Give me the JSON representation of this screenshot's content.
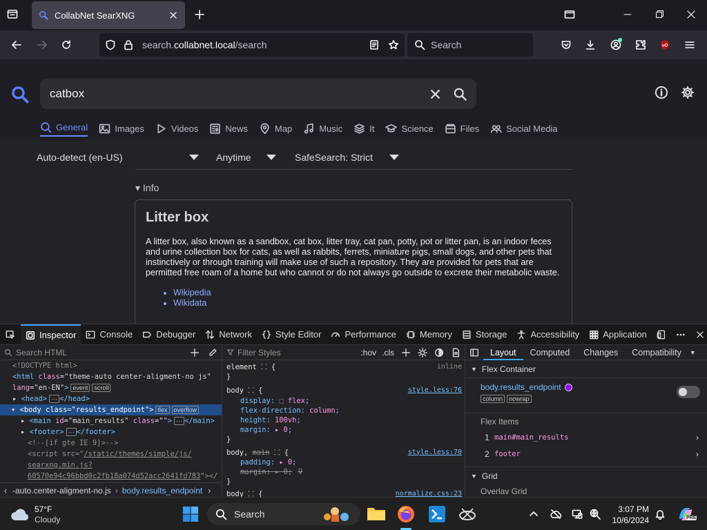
{
  "browser": {
    "tab_title": "CollabNet SearXNG",
    "url_host": "search.",
    "url_domain": "collabnet.local",
    "url_path": "/search",
    "search_placeholder": "Search"
  },
  "searx": {
    "query": "catbox",
    "categories": [
      {
        "label": "General",
        "icon": "search-icon",
        "active": true
      },
      {
        "label": "Images",
        "icon": "image-icon"
      },
      {
        "label": "Videos",
        "icon": "play-icon"
      },
      {
        "label": "News",
        "icon": "newspaper-icon"
      },
      {
        "label": "Map",
        "icon": "map-pin-icon"
      },
      {
        "label": "Music",
        "icon": "music-icon"
      },
      {
        "label": "It",
        "icon": "layers-icon"
      },
      {
        "label": "Science",
        "icon": "cap-icon"
      },
      {
        "label": "Files",
        "icon": "files-icon"
      },
      {
        "label": "Social Media",
        "icon": "people-icon"
      }
    ],
    "language": "Auto-detect (en-US)",
    "time_range": "Anytime",
    "safesearch": "SafeSearch: Strict",
    "info_toggle": "▾ Info",
    "infobox": {
      "title": "Litter box",
      "text": "A litter box, also known as a sandbox, cat box, litter tray, cat pan, potty, pot or litter pan, is an indoor feces and urine collection box for cats, as well as rabbits, ferrets, miniature pigs, small dogs, and other pets that instinctively or through training will make use of such a repository. They are provided for pets that are permitted free roam of a home but who cannot or do not always go outside to excrete their metabolic waste.",
      "links": [
        "Wikipedia",
        "Wikidata"
      ]
    }
  },
  "devtools": {
    "tabs": [
      "Inspector",
      "Console",
      "Debugger",
      "Network",
      "Style Editor",
      "Performance",
      "Memory",
      "Storage",
      "Accessibility",
      "Application"
    ],
    "search_html": "Search HTML",
    "filter_styles": "Filter Styles",
    "hov": ":hov",
    "cls": ".cls",
    "breadcrumb": [
      "-auto.center-aligment-no.js",
      "body.results_endpoint"
    ],
    "layout_tabs": [
      "Layout",
      "Computed",
      "Changes",
      "Compatibility"
    ],
    "flex_container": "Flex Container",
    "flex_element": "body.results_endpoint",
    "flex_badges": [
      "column",
      "nowrap"
    ],
    "flex_items_label": "Flex Items",
    "flex_items": [
      {
        "n": "1",
        "name": "main#main_results"
      },
      {
        "n": "2",
        "name": "footer"
      }
    ],
    "grid_label": "Grid",
    "overlay_grid": "Overlay Grid"
  },
  "taskbar": {
    "temp": "57°F",
    "weather": "Cloudy",
    "search": "Search",
    "time": "3:07 PM",
    "date": "10/6/2024"
  }
}
